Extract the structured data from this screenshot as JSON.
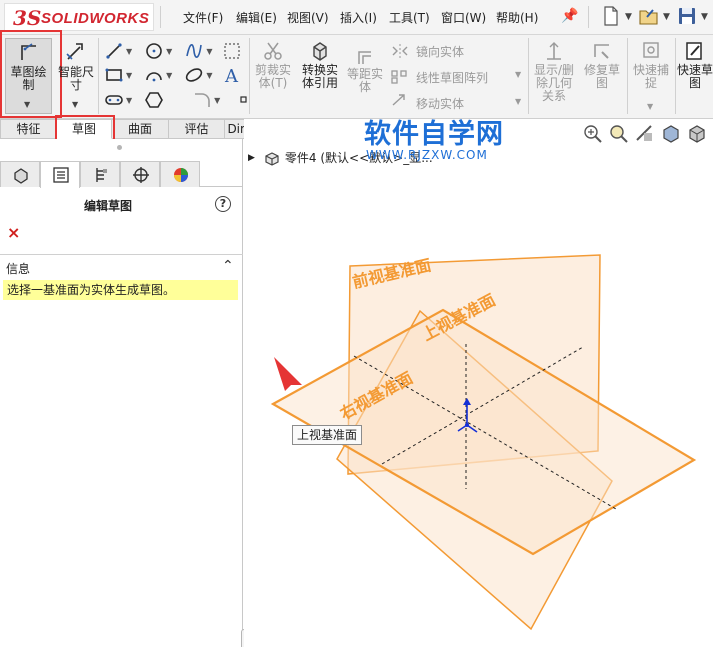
{
  "app": {
    "logo_ds": "3S",
    "logo_text": "SOLIDWORKS"
  },
  "menu": [
    {
      "label": "文件(F)"
    },
    {
      "label": "编辑(E)"
    },
    {
      "label": "视图(V)"
    },
    {
      "label": "插入(I)"
    },
    {
      "label": "工具(T)"
    },
    {
      "label": "窗口(W)"
    },
    {
      "label": "帮助(H)"
    }
  ],
  "ribbon": {
    "sketch_btn": "草图绘\n制",
    "smart_dim_btn": "智能尺\n寸",
    "trim_btn": "剪裁实\n体(T)",
    "convert_btn": "转换实\n体引用",
    "offset_btn": "等距实\n体",
    "mirror_item": "镜向实体",
    "linear_pattern_item": "线性草图阵列",
    "move_item": "移动实体",
    "show_delete_btn": "显示/删\n除几何\n关系",
    "repair_btn": "修复草\n图",
    "quick_snap_btn": "快速捕\n捉",
    "rapid_sketch_btn": "快速草\n图"
  },
  "command_tabs": [
    {
      "label": "特征"
    },
    {
      "label": "草图"
    },
    {
      "label": "曲面"
    },
    {
      "label": "评估"
    },
    {
      "label": "DimXpert"
    }
  ],
  "property_manager": {
    "title": "编辑草图",
    "help": "?",
    "close": "×",
    "info_label": "信息",
    "info_message": "选择一基准面为实体生成草图。"
  },
  "graphics": {
    "tree_label": "零件4  (默认<<默认>_显...",
    "watermark_title": "软件自学网",
    "watermark_url": "WWW.RJZXW.COM",
    "front_plane_label": "前视基准面",
    "top_plane_label": "上视基准面",
    "right_plane_label": "右视基准面",
    "tooltip": "上视基准面"
  },
  "colors": {
    "plane_orange": "#f39a34",
    "plane_fill": "#fbe3cc",
    "highlight_red": "#e53535",
    "watermark_blue": "#1e6fd6",
    "info_yellow": "#ffff99"
  }
}
